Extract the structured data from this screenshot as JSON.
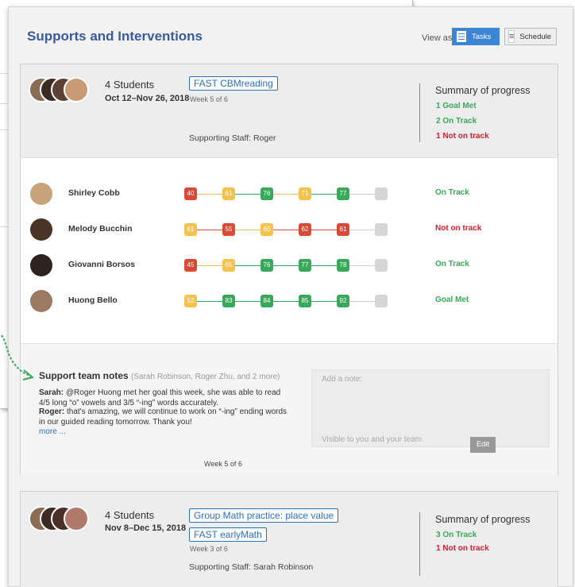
{
  "header": {
    "title": "Supports and Interventions",
    "view_as": "View as",
    "tasks_label": "Tasks",
    "schedule_label": "Schedule"
  },
  "colors": {
    "brand": "#3a5a9e",
    "tasks_active": "#3a86d4",
    "green": "#3aa85a",
    "yellow": "#f3c24f",
    "red": "#d94a36",
    "gray_empty": "#d6d6d6"
  },
  "groups": [
    {
      "students_count": "4 Students",
      "dates": "Oct 12–Nov 26, 2018",
      "programs": [
        "FAST CBMreading"
      ],
      "week": "Week 5 of 6",
      "staff": "Supporting Staff: Roger",
      "summary_title": "Summary of progress",
      "summary": [
        {
          "text": "1 Goal Met",
          "status": "green"
        },
        {
          "text": "2 On Track",
          "status": "green"
        },
        {
          "text": "1 Not on track",
          "status": "red"
        }
      ],
      "students": [
        {
          "name": "Shirley Cobb",
          "status": "On Track",
          "status_color": "green",
          "scores": [
            {
              "v": "40",
              "c": "red"
            },
            {
              "v": "61",
              "c": "yellow"
            },
            {
              "v": "76",
              "c": "green"
            },
            {
              "v": "71",
              "c": "yellow"
            },
            {
              "v": "77",
              "c": "green"
            }
          ]
        },
        {
          "name": "Melody Bucchin",
          "status": "Not on track",
          "status_color": "red",
          "scores": [
            {
              "v": "61",
              "c": "yellow"
            },
            {
              "v": "55",
              "c": "red"
            },
            {
              "v": "60",
              "c": "yellow"
            },
            {
              "v": "62",
              "c": "red"
            },
            {
              "v": "61",
              "c": "red"
            }
          ]
        },
        {
          "name": "Giovanni Borsos",
          "status": "On Track",
          "status_color": "green",
          "scores": [
            {
              "v": "45",
              "c": "red"
            },
            {
              "v": "65",
              "c": "yellow"
            },
            {
              "v": "76",
              "c": "green"
            },
            {
              "v": "77",
              "c": "green"
            },
            {
              "v": "78",
              "c": "green"
            }
          ]
        },
        {
          "name": "Huong Bello",
          "status": "Goal Met",
          "status_color": "green",
          "scores": [
            {
              "v": "52",
              "c": "yellow"
            },
            {
              "v": "83",
              "c": "green"
            },
            {
              "v": "84",
              "c": "green"
            },
            {
              "v": "85",
              "c": "green"
            },
            {
              "v": "92",
              "c": "green"
            }
          ]
        }
      ],
      "notes": {
        "title": "Support team notes",
        "who": "(Sarah Robinson, Roger Zhu, and 2 more)",
        "items": [
          {
            "author": "Sarah:",
            "text": "@Roger Huong met her goal this week, she was able to read 4/5 long “o” vowels and 3/5 “-ing” words accurately."
          },
          {
            "author": "Roger:",
            "text": "that's amazing, we will continue to work on “-ing” ending words in our guided reading tomorrow. Thank you!"
          }
        ],
        "more": "more ...",
        "week": "Week 5 of 6",
        "input_placeholder": "Add a note:",
        "visibility": "Visible to you and your team",
        "edit_label": "Edit"
      }
    },
    {
      "students_count": "4 Students",
      "dates": "Nov 8–Dec 15, 2018",
      "programs": [
        "Group Math practice: place value",
        "FAST earlyMath"
      ],
      "week": "Week 3 of 6",
      "staff": "Supporting Staff: Sarah Robinson",
      "summary_title": "Summary of progress",
      "summary": [
        {
          "text": "3 On Track",
          "status": "green"
        },
        {
          "text": "1 Not on track",
          "status": "red"
        }
      ]
    }
  ]
}
